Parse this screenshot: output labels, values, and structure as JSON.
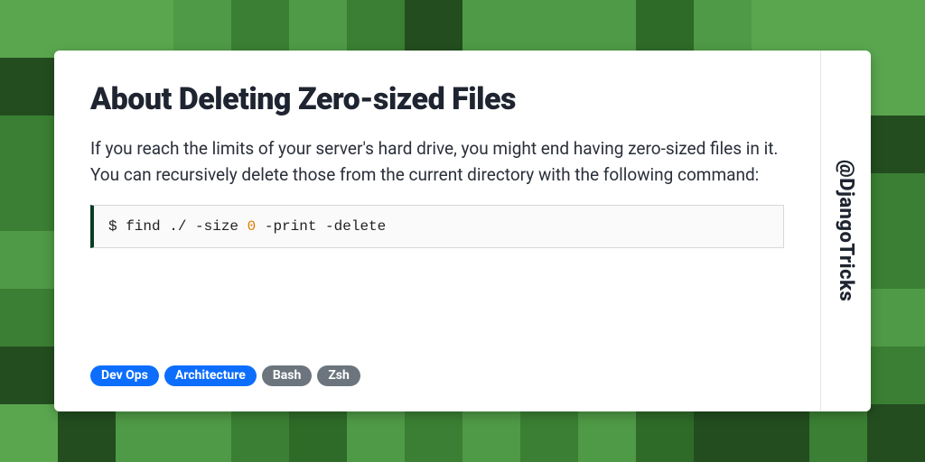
{
  "title": "About Deleting Zero-sized Files",
  "description": "If you reach the limits of your server's hard drive, you might end having zero-sized files in it. You can recursively delete those from the current directory with the following command:",
  "code": {
    "prefix": "$ find ./ -size ",
    "highlight": "0",
    "suffix": " -print -delete"
  },
  "tags": [
    {
      "label": "Dev Ops",
      "kind": "primary"
    },
    {
      "label": "Architecture",
      "kind": "primary"
    },
    {
      "label": "Bash",
      "kind": "secondary"
    },
    {
      "label": "Zsh",
      "kind": "secondary"
    }
  ],
  "handle": "@DjangoTricks",
  "bg_palette": [
    "#234d1f",
    "#2e6a28",
    "#3a7f33",
    "#4f9a46",
    "#5aa64f"
  ]
}
